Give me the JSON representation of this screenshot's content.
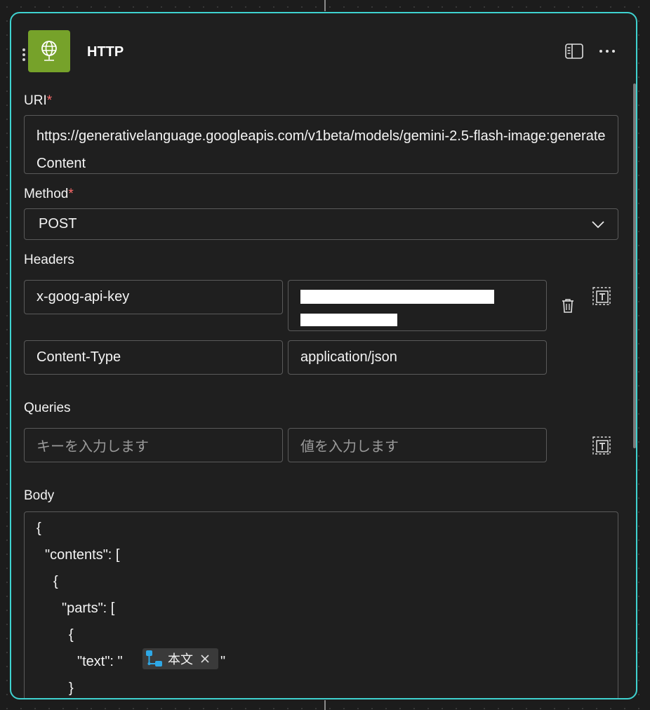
{
  "card": {
    "title": "HTTP",
    "accent_color": "#3fd2d0",
    "icon_bg": "#76a22a",
    "icons": {
      "app": "globe-icon",
      "panel": "panel-icon",
      "more": "ellipsis-icon",
      "delete": "trash-icon",
      "text_mode": "text-mode-icon"
    }
  },
  "uri": {
    "label": "URI",
    "required_mark": "*",
    "value": "https://generativelanguage.googleapis.com/v1beta/models/gemini-2.5-flash-image:generateContent"
  },
  "method": {
    "label": "Method",
    "required_mark": "*",
    "value": "POST"
  },
  "headers": {
    "label": "Headers",
    "rows": [
      {
        "key": "x-goog-api-key",
        "value": ""
      },
      {
        "key": "Content-Type",
        "value": "application/json"
      }
    ]
  },
  "queries": {
    "label": "Queries",
    "key_placeholder": "キーを入力します",
    "value_placeholder": "値を入力します"
  },
  "body": {
    "label": "Body",
    "lines": [
      "{",
      "\"contents\": [",
      "{",
      "\"parts\": [",
      "{",
      "\"text\": \"",
      "\"",
      "}"
    ],
    "token": {
      "label": "本文",
      "icon": "dynamic-content-icon"
    }
  }
}
